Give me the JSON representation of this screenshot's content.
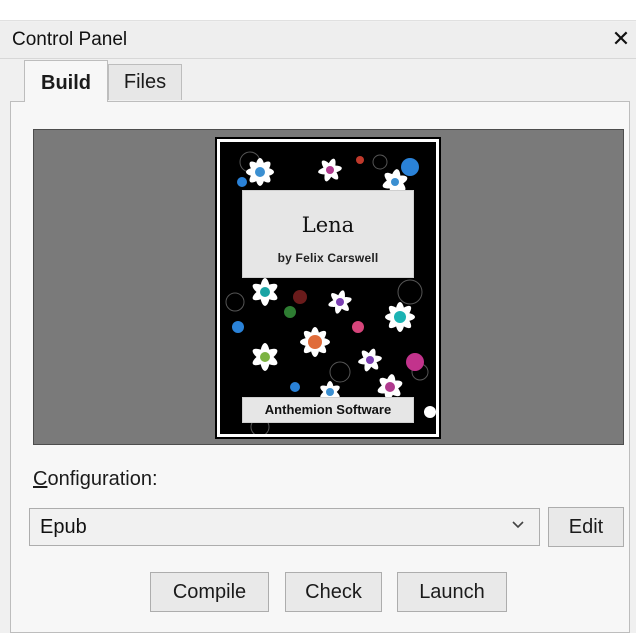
{
  "window": {
    "title": "Control Panel",
    "close_glyph": "✕"
  },
  "tabs": [
    {
      "label": "Build",
      "active": true
    },
    {
      "label": "Files",
      "active": false
    }
  ],
  "preview": {
    "cover_title": "Lena",
    "cover_author": "by Felix Carswell",
    "cover_publisher": "Anthemion Software"
  },
  "configuration": {
    "label_accel": "C",
    "label_rest": "onfiguration:",
    "selected": "Epub",
    "edit_label": "Edit"
  },
  "actions": {
    "compile_label": "Compile",
    "check_label": "Check",
    "launch_label": "Launch"
  },
  "icons": {
    "dropdown": "chevron-down-icon",
    "close": "close-icon"
  },
  "colors": {
    "preview_bg": "#7a7a7a",
    "window_bg": "#f0f0f0"
  }
}
